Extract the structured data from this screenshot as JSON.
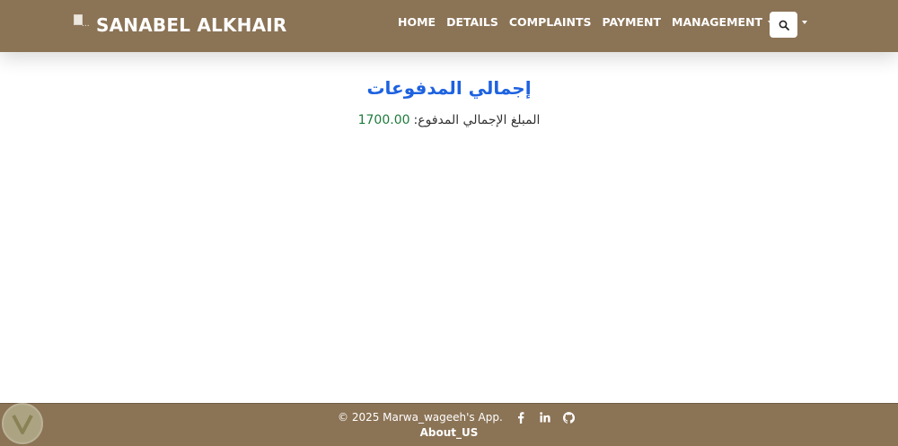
{
  "brand": {
    "name": "SANABEL ALKHAIR",
    "logo_icon": "broken-image-icon"
  },
  "nav": {
    "items": [
      {
        "label": "HOME"
      },
      {
        "label": "DETAILS"
      },
      {
        "label": "COMPLAINTS"
      },
      {
        "label": "PAYMENT"
      }
    ],
    "management_label": "MANAGEMENT",
    "user_icon": "user-icon"
  },
  "search": {
    "icon": "search-icon"
  },
  "main": {
    "title": "إجمالي المدفوعات",
    "total_label": "المبلغ الإجمالي المدفوع:",
    "total_value": "1700.00"
  },
  "footer": {
    "copyright": "© 2025 Marwa_wageeh's App.",
    "social_icons": [
      "facebook-icon",
      "linkedin-icon",
      "github-icon"
    ],
    "about_label": "About_US"
  },
  "colors": {
    "navbar_bg": "#8b7355",
    "footer_bg": "#8b7355",
    "title": "#1d62e0",
    "amount": "#1e7b3c"
  }
}
